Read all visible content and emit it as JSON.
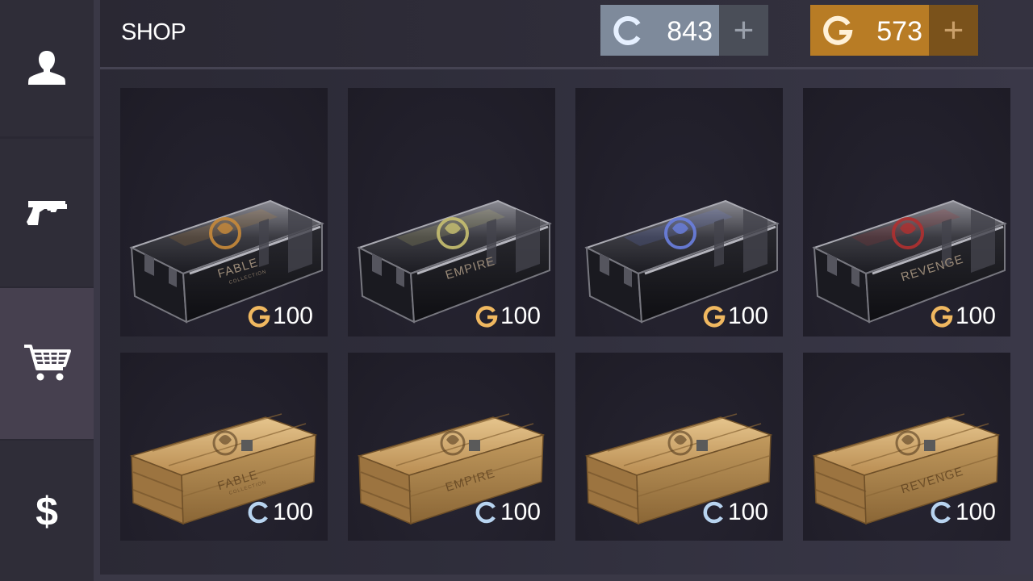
{
  "header": {
    "title": "SHOP",
    "credits": {
      "value": "843",
      "icon": "credits-c-icon",
      "plus": "+",
      "color": "#7e8a9b"
    },
    "gold": {
      "value": "573",
      "icon": "gold-g-icon",
      "plus": "+",
      "color": "#b87c25"
    }
  },
  "sidebar": {
    "items": [
      {
        "name": "profile",
        "icon": "person-icon"
      },
      {
        "name": "weapons",
        "icon": "pistol-icon"
      },
      {
        "name": "shop",
        "icon": "cart-icon",
        "active": true
      },
      {
        "name": "bank",
        "icon": "dollar-icon"
      }
    ]
  },
  "cases": [
    {
      "label": "FABLE",
      "sublabel": "COLLECTION",
      "price": "100",
      "currency": "gold",
      "type": "metal",
      "accent": "#c88a3a"
    },
    {
      "label": "EMPIRE",
      "price": "100",
      "currency": "gold",
      "type": "metal",
      "accent": "#c8c070"
    },
    {
      "label": "",
      "price": "100",
      "currency": "gold",
      "type": "metal",
      "accent": "#6a80e0"
    },
    {
      "label": "REVENGE",
      "price": "100",
      "currency": "gold",
      "type": "metal",
      "accent": "#b03030"
    },
    {
      "label": "FABLE",
      "sublabel": "COLLECTION",
      "price": "100",
      "currency": "credits",
      "type": "wood"
    },
    {
      "label": "EMPIRE",
      "price": "100",
      "currency": "credits",
      "type": "wood"
    },
    {
      "label": "",
      "price": "100",
      "currency": "credits",
      "type": "wood"
    },
    {
      "label": "REVENGE",
      "price": "100",
      "currency": "credits",
      "type": "wood"
    }
  ]
}
